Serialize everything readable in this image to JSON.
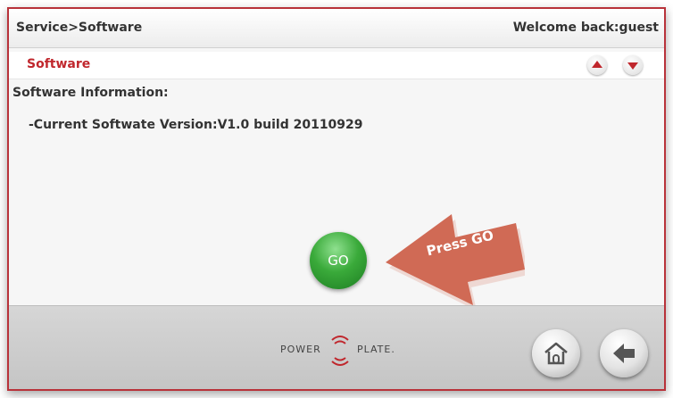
{
  "header": {
    "breadcrumb": "Service>Software",
    "welcome": "Welcome back:guest"
  },
  "section": {
    "title": "Software"
  },
  "content": {
    "info_label": "Software Information:",
    "version_line": "-Current Softwate Version:V1.0 build 20110929"
  },
  "go_button": {
    "label": "GO"
  },
  "callout": {
    "label": "Press GO"
  },
  "footer": {
    "logo_left": "POWER",
    "logo_right": "PLATE."
  },
  "icons": {
    "up": "arrow-up-icon",
    "down": "arrow-down-icon",
    "home": "home-icon",
    "back": "back-icon"
  },
  "colors": {
    "accent": "#c0272d",
    "go": "#2fa33a",
    "callout": "#d06a55"
  }
}
